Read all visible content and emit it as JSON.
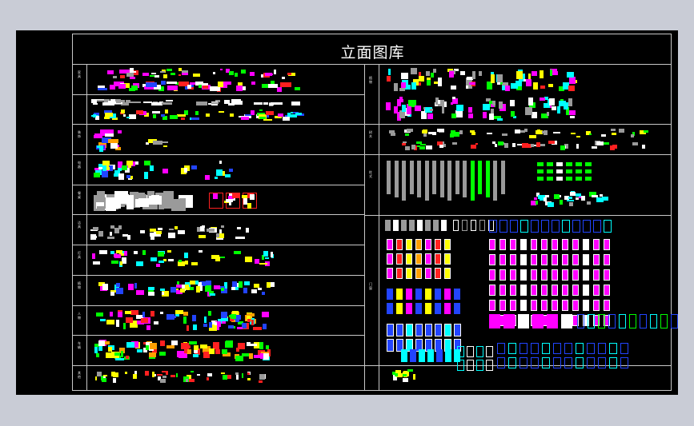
{
  "drawing": {
    "title": "立面图库",
    "background": "#000000",
    "frame_color": "#c8c8c8",
    "palette": [
      "#ffffff",
      "#00ff00",
      "#ff00ff",
      "#0044ff",
      "#ffff00",
      "#00ffff",
      "#ff0000",
      "#808080",
      "#ffa000"
    ]
  },
  "left_categories": [
    "家具",
    "装饰",
    "电器",
    "餐桌",
    "洁具",
    "灯具",
    "植物",
    "人物",
    "车辆",
    "其他",
    "配景"
  ],
  "right_categories": [
    "植物",
    "树木",
    "柱式",
    "门窗"
  ]
}
